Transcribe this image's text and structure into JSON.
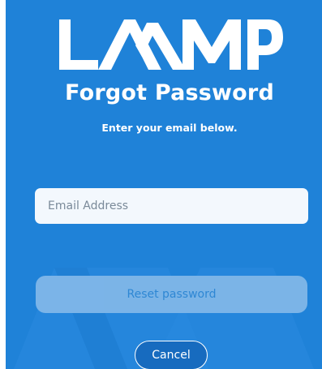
{
  "brand": {
    "logo_text": "LAMP",
    "logo_icon": "lamp-logo-icon"
  },
  "header": {
    "title": "Forgot Password",
    "subtitle": "Enter your email below."
  },
  "form": {
    "email": {
      "value": "",
      "placeholder": "Email Address"
    },
    "reset_label": "Reset password",
    "cancel_label": "Cancel"
  },
  "colors": {
    "background": "#1f82d8",
    "field_bg": "#f3f8fd",
    "reset_button_bg": "#7eb6e8",
    "reset_button_text": "#2f88d4",
    "cancel_button_bg": "#176bbf",
    "text": "#ffffff"
  }
}
